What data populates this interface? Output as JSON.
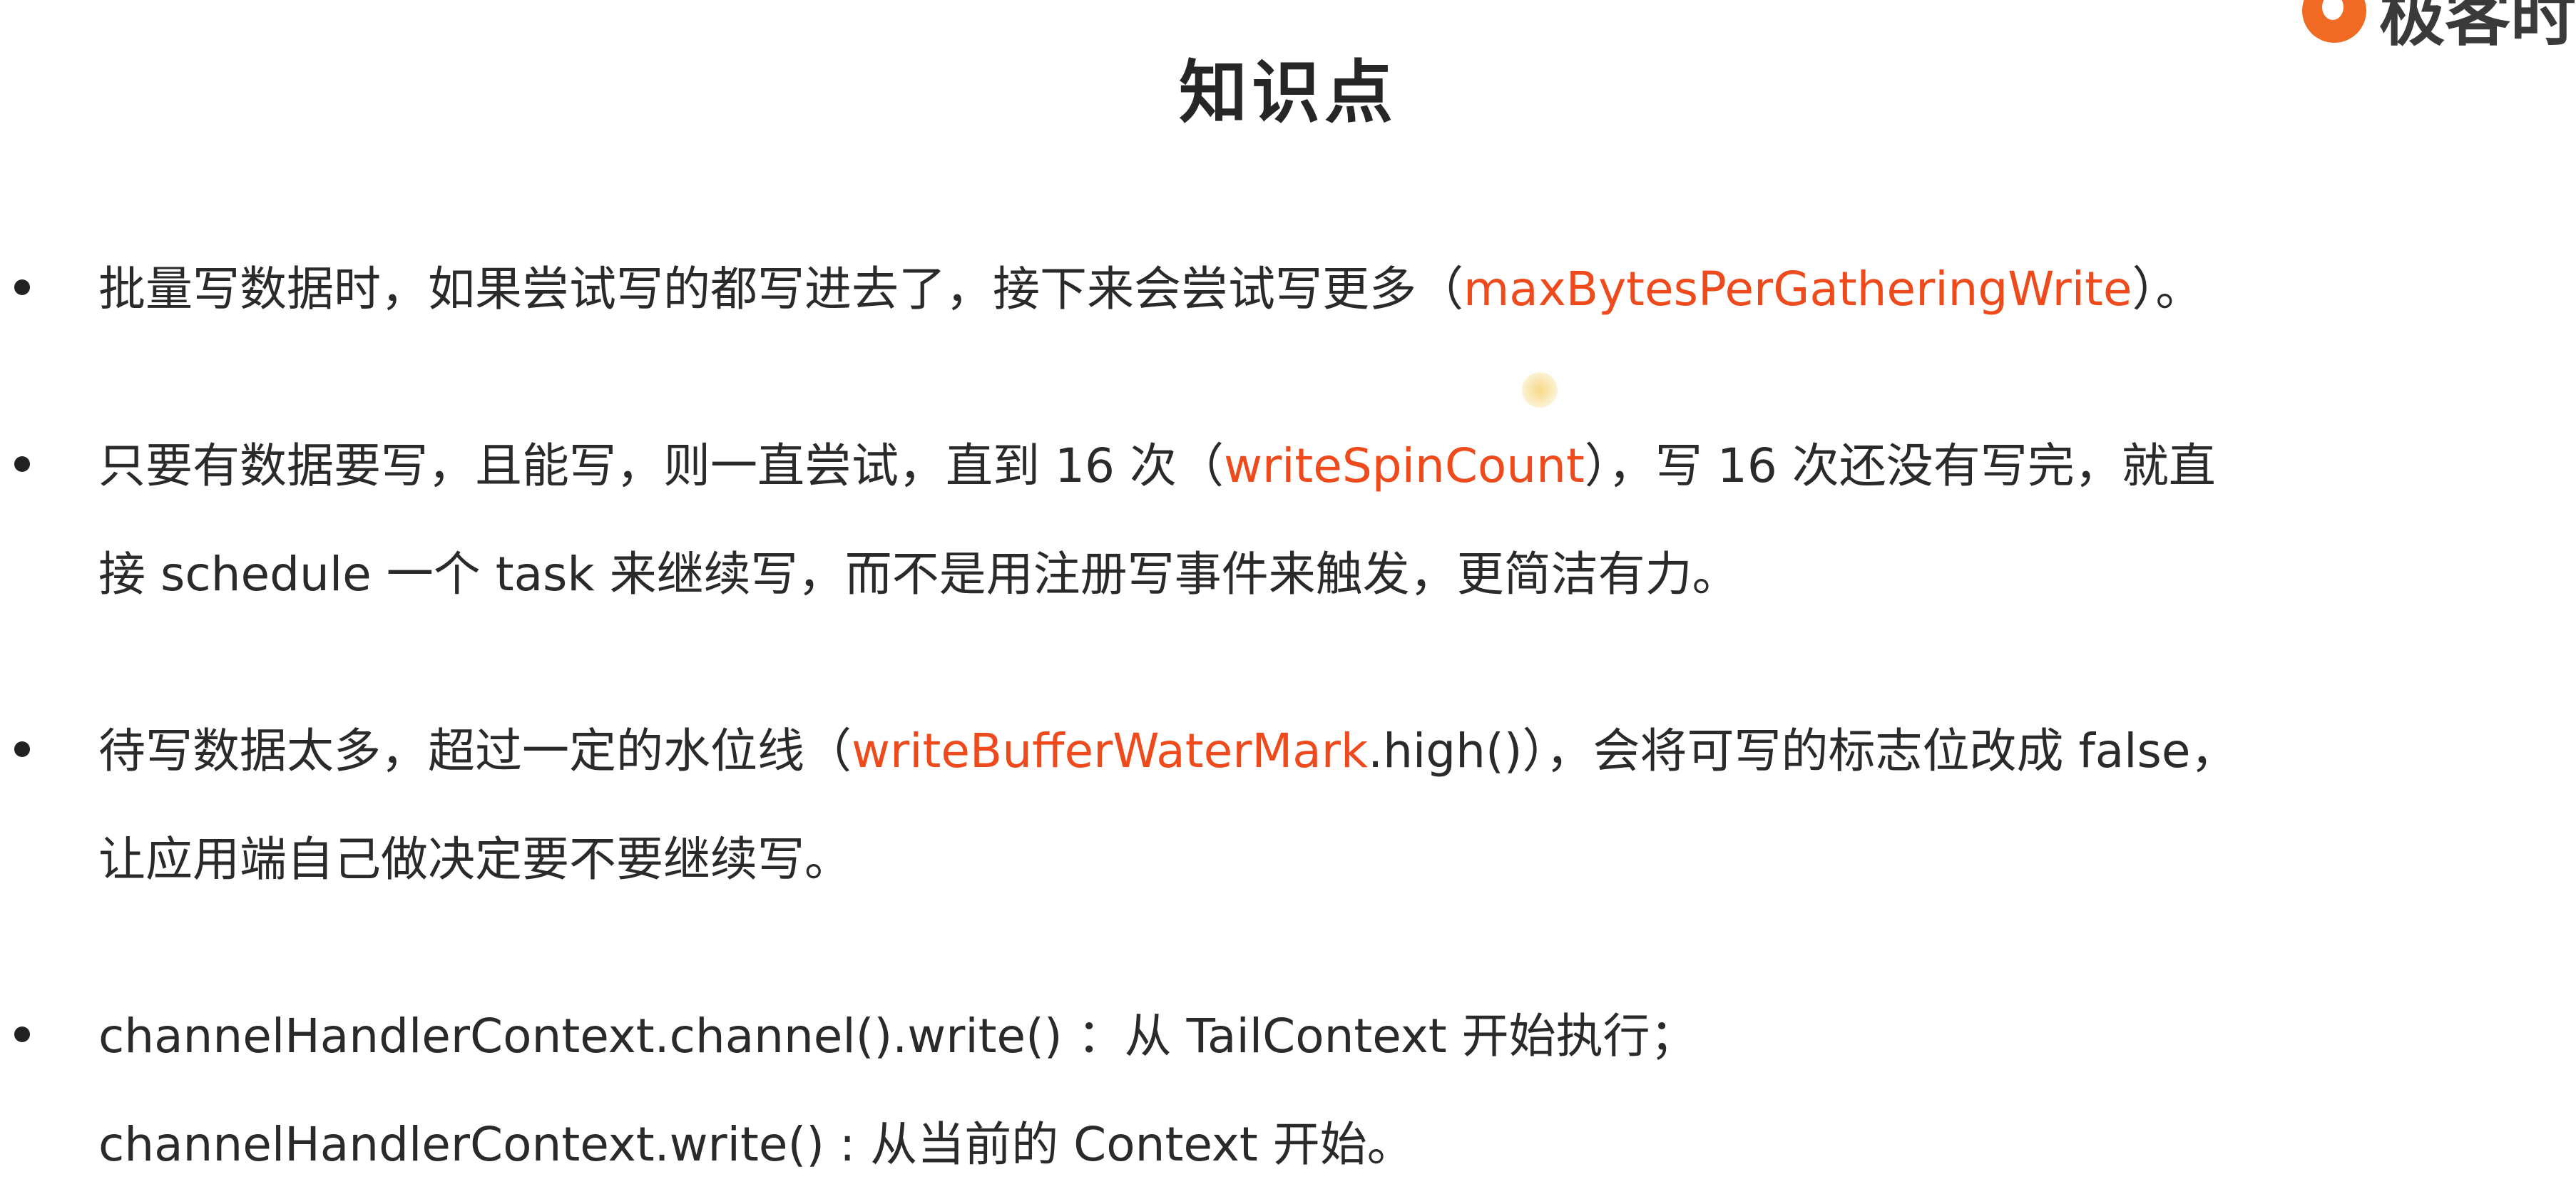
{
  "logo": {
    "text": "极客时",
    "icon": "geektime-logo-icon",
    "accent_color": "#f06a23"
  },
  "title": "知识点",
  "highlight_color": "#ee4a1c",
  "bullets": [
    {
      "lines": [
        {
          "a": "批量写数据时，如果尝试写的都写进去了，接下来会尝试写更多（",
          "hl": "maxBytesPerGatheringWrite",
          "b": "）。"
        }
      ]
    },
    {
      "lines": [
        {
          "a": "只要有数据要写，且能写，则一直尝试，直到 16 次（",
          "hl": "writeSpinCount",
          "b": "），写 16 次还没有写完，就直"
        },
        {
          "a": "接 schedule 一个 task 来继续写，而不是用注册写事件来触发，更简洁有力。"
        }
      ]
    },
    {
      "lines": [
        {
          "a": "待写数据太多，超过一定的水位线（",
          "hl": "writeBufferWaterMark",
          "b": ".high()），会将可写的标志位改成 false，"
        },
        {
          "a": "让应用端自己做决定要不要继续写。"
        }
      ]
    },
    {
      "lines": [
        {
          "a": "channelHandlerContext.channel().write() ：从 TailContext 开始执行；"
        },
        {
          "a": "channelHandlerContext.write() : 从当前的 Context 开始。"
        }
      ]
    }
  ]
}
